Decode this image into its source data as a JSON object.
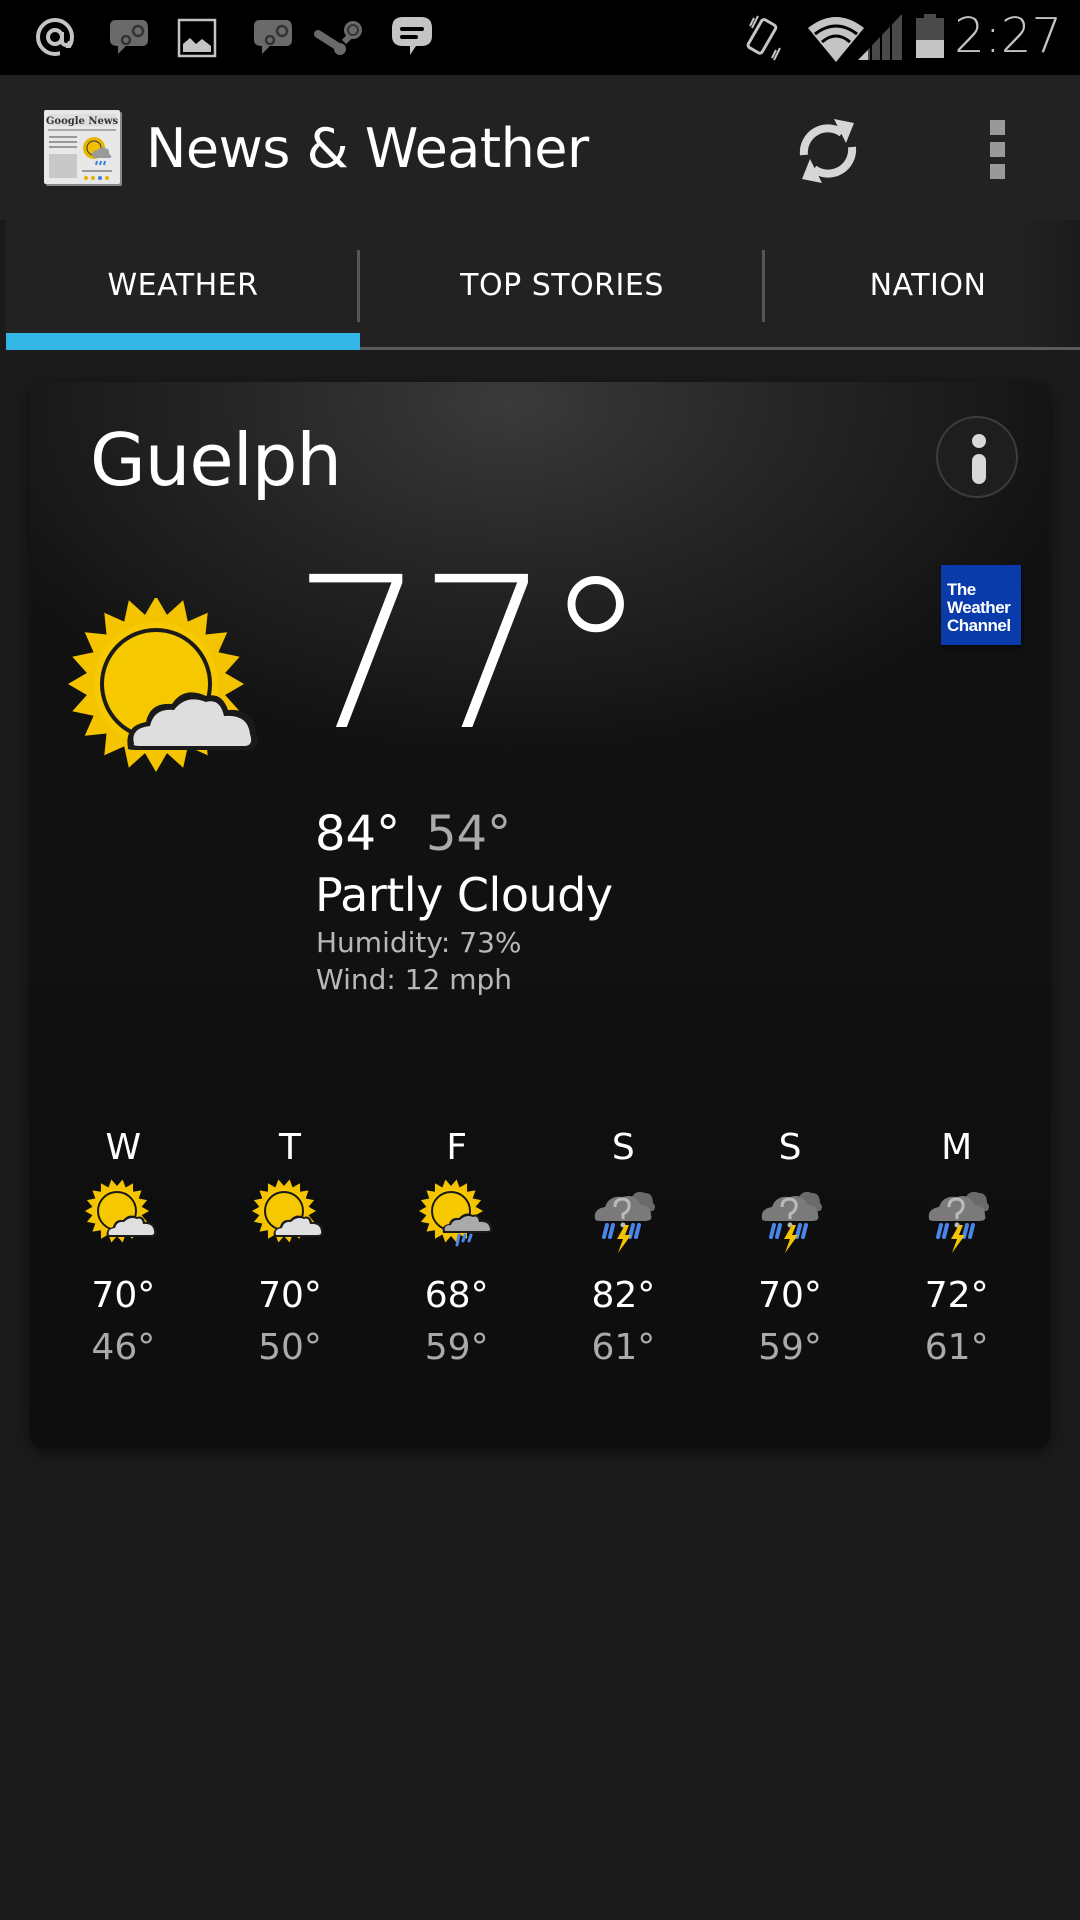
{
  "status_bar": {
    "notification_icons": [
      "at-sign-icon",
      "steam-chat-icon",
      "gallery-icon",
      "steam-chat-icon",
      "steam-icon",
      "message-icon"
    ],
    "system_icons": [
      "vibrate-icon",
      "wifi-icon",
      "cell-signal-icon",
      "battery-icon"
    ],
    "time": "2:27"
  },
  "action_bar": {
    "title": "News & Weather",
    "app_icon": "google-news-icon",
    "actions": [
      "refresh-icon",
      "overflow-menu-icon"
    ]
  },
  "tabs": {
    "items": [
      {
        "label": "WEATHER",
        "selected": true
      },
      {
        "label": "TOP STORIES",
        "selected": false
      },
      {
        "label": "NATION",
        "selected": false
      }
    ],
    "accent_color": "#33b5e5"
  },
  "weather": {
    "city": "Guelph",
    "current_temp": "77°",
    "condition_icon": "partly-cloudy-icon",
    "high": "84°",
    "low": "54°",
    "condition": "Partly Cloudy",
    "humidity": "Humidity: 73%",
    "wind": "Wind: 12 mph",
    "provider": {
      "lines": [
        "The",
        "Weather",
        "Channel"
      ],
      "color": "#0a3bab"
    },
    "forecast": [
      {
        "day": "W",
        "icon": "partly-cloudy-icon",
        "high": "70°",
        "low": "46°"
      },
      {
        "day": "T",
        "icon": "partly-cloudy-icon",
        "high": "70°",
        "low": "50°"
      },
      {
        "day": "F",
        "icon": "chance-of-rain-icon",
        "high": "68°",
        "low": "59°"
      },
      {
        "day": "S",
        "icon": "chance-of-storm-icon",
        "high": "82°",
        "low": "61°"
      },
      {
        "day": "S",
        "icon": "chance-of-storm-icon",
        "high": "70°",
        "low": "59°"
      },
      {
        "day": "M",
        "icon": "chance-of-storm-icon",
        "high": "72°",
        "low": "61°"
      }
    ]
  }
}
